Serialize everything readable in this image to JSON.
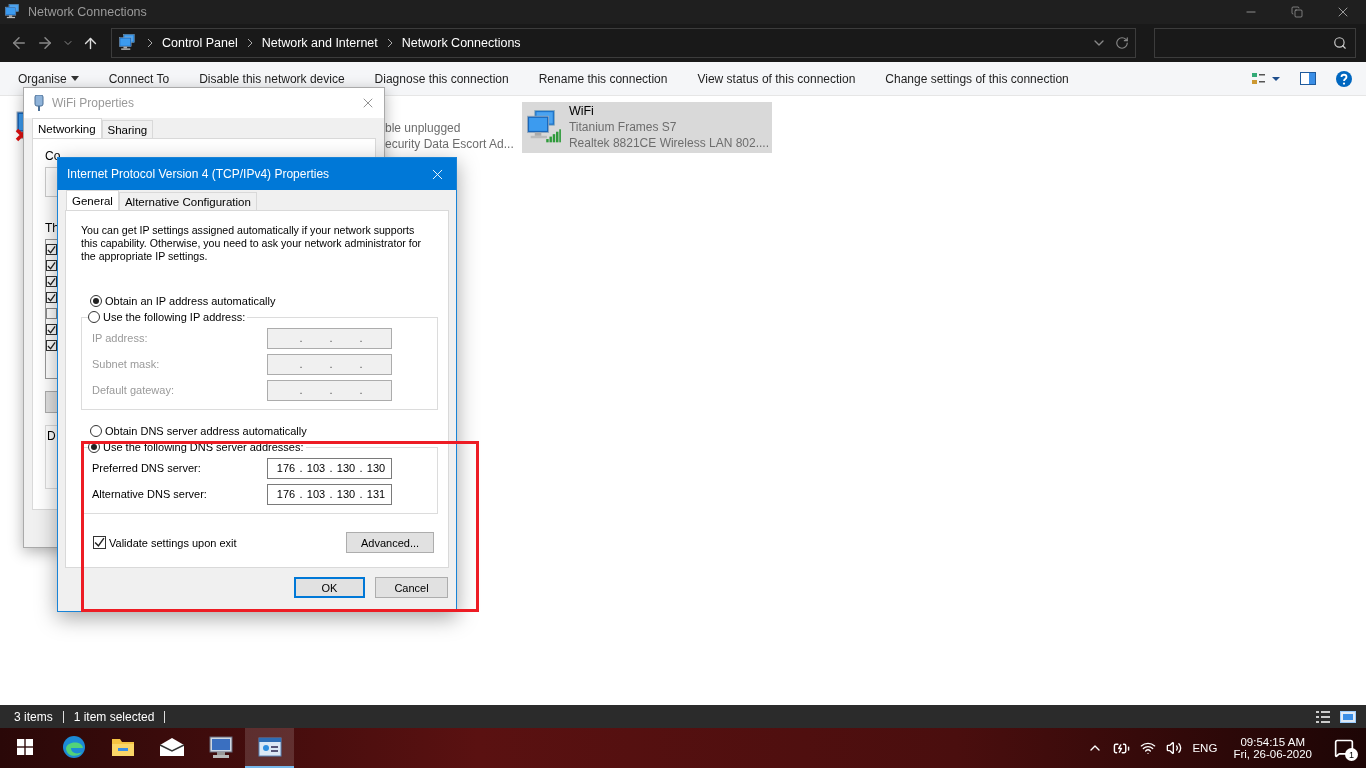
{
  "window": {
    "title": "Network Connections"
  },
  "address_bar": {
    "breadcrumb": [
      "Control Panel",
      "Network and Internet",
      "Network Connections"
    ]
  },
  "command_bar": [
    {
      "label": "Organise",
      "menu": true
    },
    {
      "label": "Connect To",
      "menu": false
    },
    {
      "label": "Disable this network device",
      "menu": false
    },
    {
      "label": "Diagnose this connection",
      "menu": false
    },
    {
      "label": "Rename this connection",
      "menu": false
    },
    {
      "label": "View status of this connection",
      "menu": false
    },
    {
      "label": "Change settings of this connection",
      "menu": false
    }
  ],
  "connections": [
    {
      "kind": "icon",
      "disconnected": true,
      "selected": false
    },
    {
      "kind": "text",
      "lines": [
        "ble unplugged",
        "ecurity Data Escort Ad..."
      ],
      "selected": false
    },
    {
      "kind": "full",
      "name": "WiFi",
      "lines": [
        "Titanium Frames S7",
        "Realtek 8821CE Wireless LAN 802...."
      ],
      "selected": true
    }
  ],
  "status_bar": {
    "items": [
      "3 items",
      "1 item selected"
    ]
  },
  "wifi_properties": {
    "title": "WiFi Properties",
    "tabs": [
      {
        "label": "Networking",
        "selected": true
      },
      {
        "label": "Sharing",
        "selected": false
      }
    ],
    "labels": [
      "Co",
      "Th",
      "D"
    ],
    "components": [
      {
        "checked": true
      },
      {
        "checked": true
      },
      {
        "checked": true
      },
      {
        "checked": true
      },
      {
        "checked": false
      },
      {
        "checked": true
      },
      {
        "checked": true
      }
    ]
  },
  "tcp_dialog": {
    "title": "Internet Protocol Version 4 (TCP/IPv4) Properties",
    "tabs": [
      {
        "label": "General",
        "selected": true
      },
      {
        "label": "Alternative Configuration",
        "selected": false
      }
    ],
    "intro": "You can get IP settings assigned automatically if your network supports this capability. Otherwise, you need to ask your network administrator for the appropriate IP settings.",
    "separator": ".",
    "ip_mode": [
      {
        "label": "Obtain an IP address automatically",
        "selected": true
      },
      {
        "label": "Use the following IP address:",
        "selected": false
      }
    ],
    "ip_fields": [
      {
        "label": "IP address:",
        "disabled": true
      },
      {
        "label": "Subnet mask:",
        "disabled": true
      },
      {
        "label": "Default gateway:",
        "disabled": true
      }
    ],
    "dns_mode": [
      {
        "label": "Obtain DNS server address automatically",
        "selected": false
      },
      {
        "label": "Use the following DNS server addresses:",
        "selected": true
      }
    ],
    "dns_fields": [
      {
        "label": "Preferred DNS server:",
        "disabled": false,
        "octets": [
          "176",
          "103",
          "130",
          "130"
        ]
      },
      {
        "label": "Alternative DNS server:",
        "disabled": false,
        "octets": [
          "176",
          "103",
          "130",
          "131"
        ]
      }
    ],
    "validate": {
      "label": "Validate settings upon exit",
      "checked": true
    },
    "advanced_button": "Advanced...",
    "buttons": [
      {
        "label": "OK",
        "default": true
      },
      {
        "label": "Cancel",
        "default": false
      }
    ]
  },
  "annotation": {
    "color": "#ed1c24"
  },
  "taskbar": {
    "apps": [
      {
        "kind": "start",
        "active": false
      },
      {
        "kind": "browser",
        "active": false
      },
      {
        "kind": "folder",
        "active": false
      },
      {
        "kind": "mail",
        "active": false
      },
      {
        "kind": "network",
        "active": false
      },
      {
        "kind": "panel",
        "active": true
      }
    ],
    "language": "ENG",
    "time": "09:54:15 AM",
    "date": "Fri, 26-06-2020",
    "notifications": "1"
  }
}
